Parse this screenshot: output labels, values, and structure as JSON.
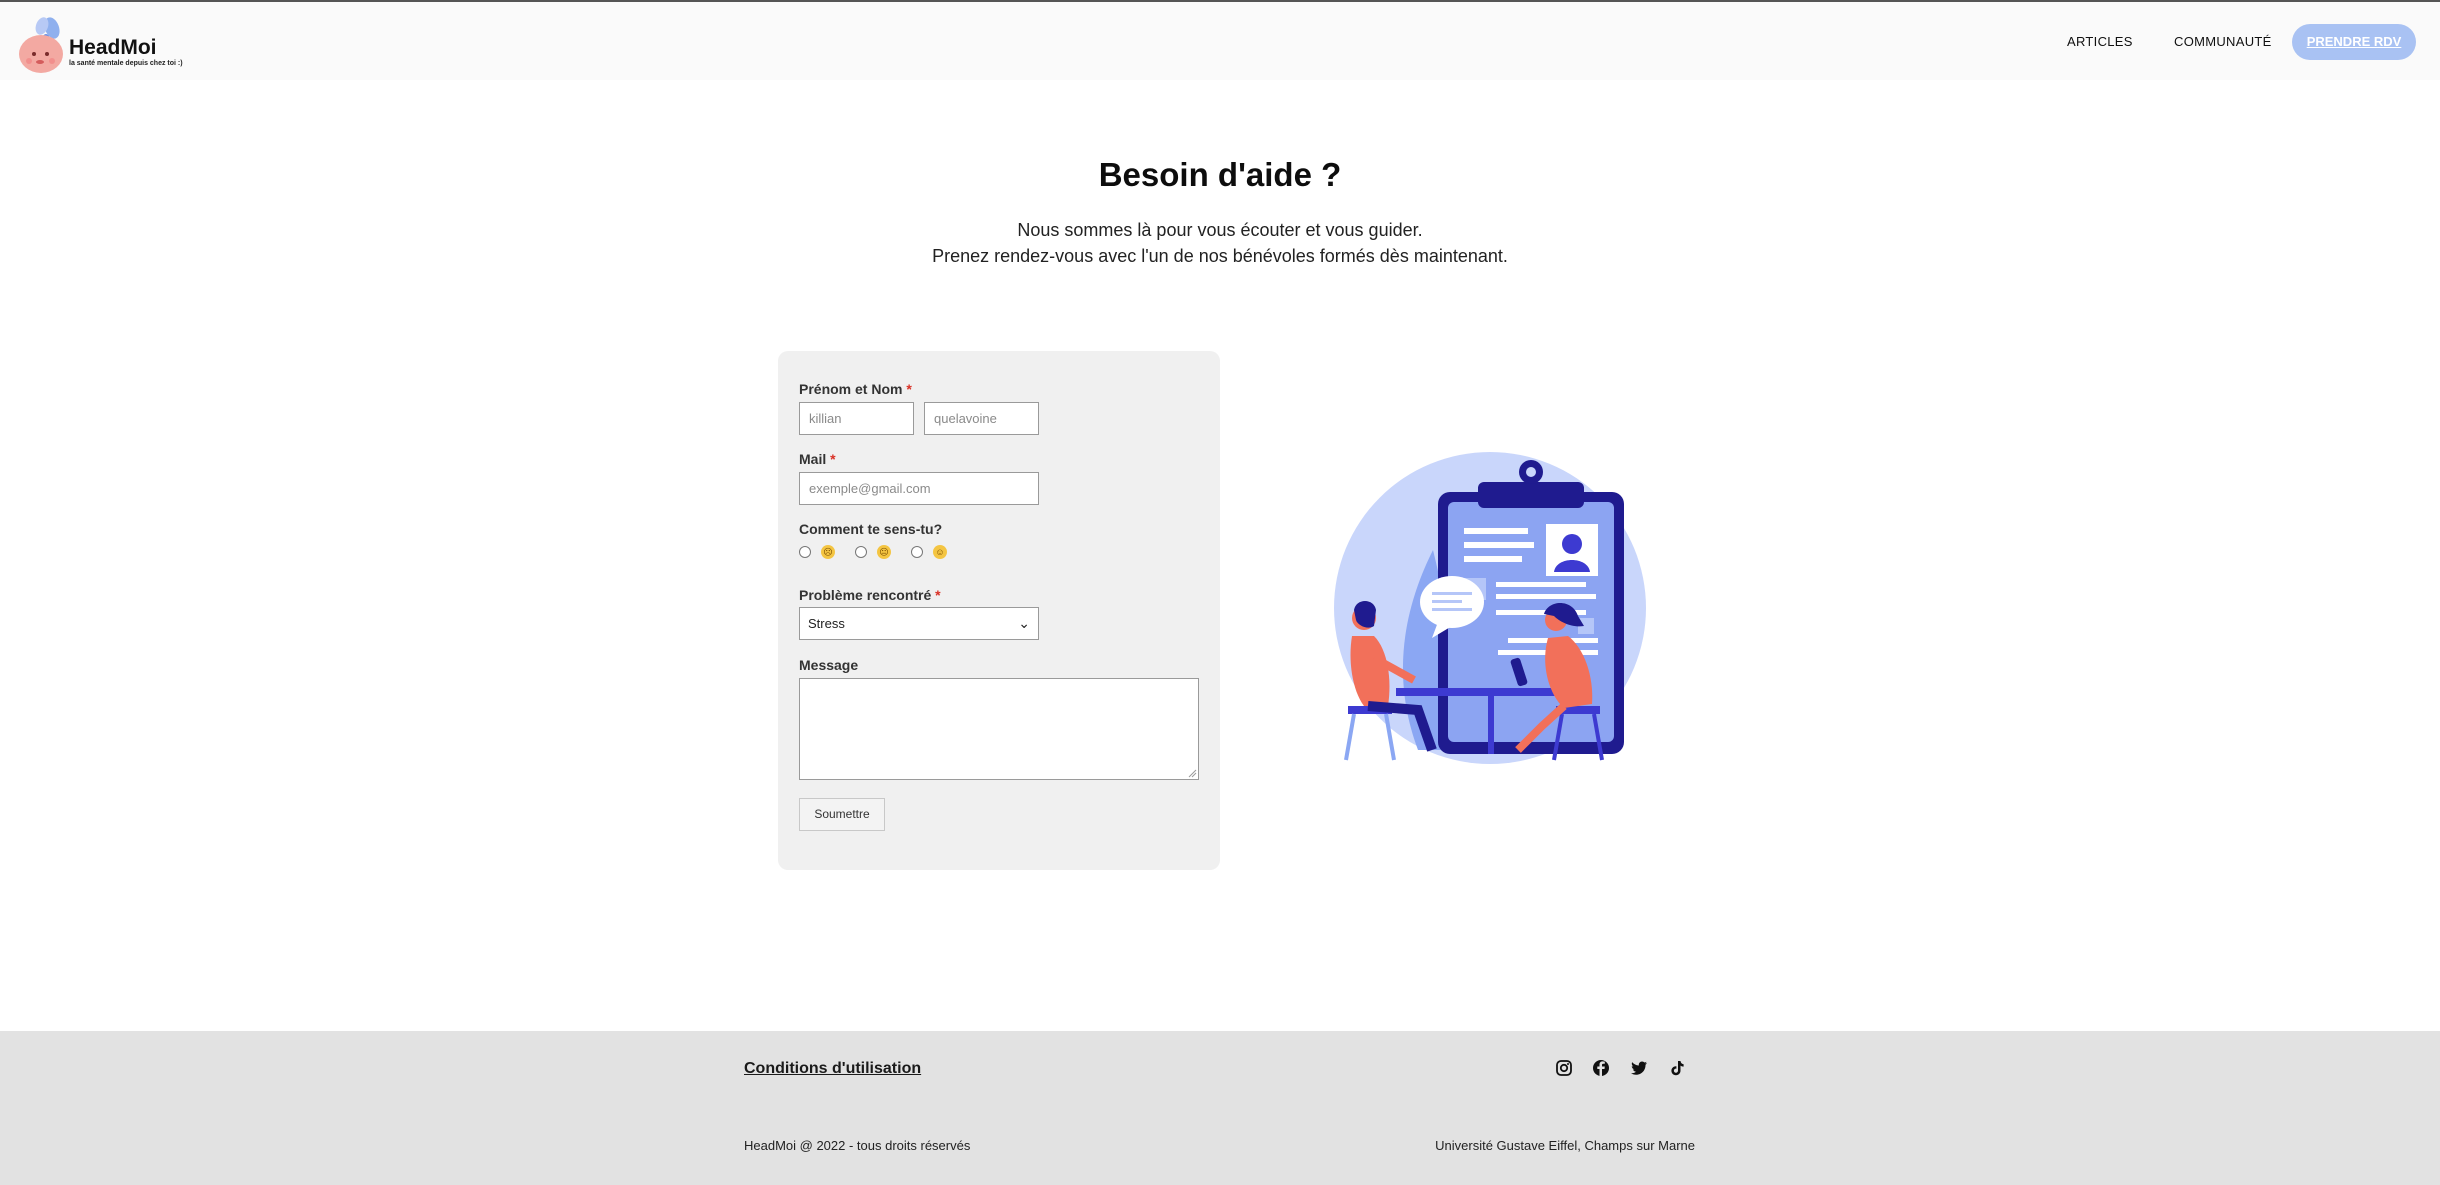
{
  "header": {
    "logo_title": "HeadMoi",
    "logo_tagline": "la santé mentale depuis chez toi :)",
    "nav": [
      {
        "label": "ARTICLES"
      },
      {
        "label": "COMMUNAUTÉ"
      }
    ],
    "cta_label": "PRENDRE RDV"
  },
  "hero": {
    "title": "Besoin d'aide ?",
    "line1": "Nous sommes là pour vous écouter et vous guider.",
    "line2": "Prenez rendez-vous avec l'un de nos bénévoles formés dès maintenant."
  },
  "form": {
    "name_label": "Prénom et Nom",
    "first_name_placeholder": "killian",
    "last_name_placeholder": "quelavoine",
    "mail_label": "Mail",
    "mail_placeholder": "exemple@gmail.com",
    "mood_label": "Comment te sens-tu?",
    "mood_options": [
      "sad",
      "neutral",
      "happy"
    ],
    "problem_label": "Problème rencontré",
    "problem_selected": "Stress",
    "message_label": "Message",
    "submit_label": "Soumettre",
    "required_mark": "*"
  },
  "footer": {
    "terms_label": "Conditions d'utilisation",
    "social_icons": [
      "instagram-icon",
      "facebook-icon",
      "twitter-icon",
      "tiktok-icon"
    ],
    "copyright": "HeadMoi @ 2022 - tous droits réservés",
    "university": "Université Gustave Eiffel, Champs sur Marne"
  },
  "colors": {
    "cta": "#a9c2f3",
    "illustration_blue": "#3d3ad1",
    "illustration_light": "#c9d6fb",
    "accent_red": "#f2705a",
    "footer_bg": "#e2e2e2",
    "card_bg": "#f0f0f0"
  }
}
